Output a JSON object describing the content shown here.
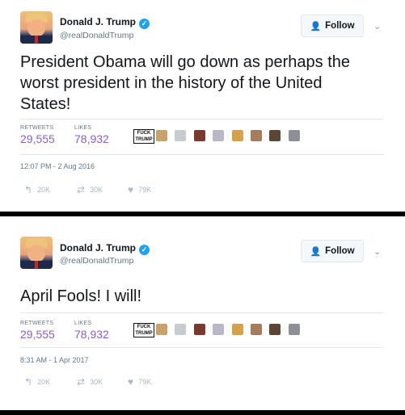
{
  "tweets": [
    {
      "name": "Donald J. Trump",
      "handle": "@realDonaldTrump",
      "follow_label": "Follow",
      "text": "President Obama will go down as perhaps the worst president in the history of the United States!",
      "retweets_label": "RETWEETS",
      "retweets": "29,555",
      "likes_label": "LIKES",
      "likes": "78,932",
      "timestamp": "12:07 PM - 2 Aug 2016",
      "reply_count": "20K",
      "retweet_count": "30K",
      "like_count": "79K"
    },
    {
      "name": "Donald J. Trump",
      "handle": "@realDonaldTrump",
      "follow_label": "Follow",
      "text": "April Fools! I will!",
      "retweets_label": "RETWEETS",
      "retweets": "29,555",
      "likes_label": "LIKES",
      "likes": "78,932",
      "timestamp": "8:31 AM - 1 Apr 2017",
      "reply_count": "20K",
      "retweet_count": "30K",
      "like_count": "79K"
    }
  ],
  "avatar_badge_lines": [
    "FUCK",
    "TRUMP"
  ],
  "colors": {
    "stat_value": "#8a5fbf",
    "verified": "#1da1f2",
    "separator": "#000000"
  }
}
